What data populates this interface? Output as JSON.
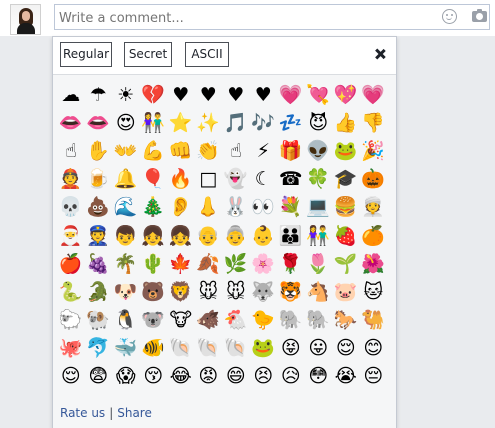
{
  "comment_box": {
    "placeholder": "Write a comment...",
    "value": ""
  },
  "picker": {
    "tabs": [
      "Regular",
      "Secret",
      "ASCII"
    ],
    "footer": {
      "rate": "Rate us",
      "separator": "|",
      "share": "Share"
    }
  },
  "emojis": [
    "☁",
    "☂",
    "☀",
    "💔",
    "♥",
    "♥",
    "♥",
    "♥",
    "💗",
    "💘",
    "💖",
    "💗",
    "👄",
    "👄",
    "😍",
    "👫",
    "⭐",
    "✨",
    "🎵",
    "🎶",
    "💤",
    "😈",
    "👍",
    "👎",
    "☝",
    "✋",
    "👐",
    "💪",
    "👊",
    "👏",
    "☝",
    "⚡",
    "🎁",
    "👽",
    "🐸",
    "🎉",
    "👲",
    "🍺",
    "🔔",
    "🎈",
    "🔥",
    "□",
    "👻",
    "☾",
    "☎",
    "🍀",
    "🎓",
    "🎃",
    "💀",
    "💩",
    "🌊",
    "🎄",
    "👂",
    "👃",
    "🐰",
    "👀",
    "💐",
    "💻",
    "🍔",
    "👳",
    "🎅",
    "👮",
    "👦",
    "👧",
    "👧",
    "👴",
    "👵",
    "👶",
    "👪",
    "👫",
    "🍓",
    "🍊",
    "🍎",
    "🍇",
    "🌴",
    "🌵",
    "🍁",
    "🍂",
    "🌿",
    "🌸",
    "🌹",
    "🌷",
    "🌱",
    "🌺",
    "🐍",
    "🐊",
    "🐶",
    "🐻",
    "🦁",
    "🐭",
    "🐭",
    "🐺",
    "🐯",
    "🐴",
    "🐷",
    "🐱",
    "🐑",
    "🐏",
    "🐧",
    "🐨",
    "🐮",
    "🐗",
    "🐔",
    "🐤",
    "🐘",
    "🐘",
    "🐎",
    "🐫",
    "🐙",
    "🐬",
    "🐳",
    "🐠",
    "🐚",
    "🐚",
    "🐚",
    "🐸",
    "😝",
    "😛",
    "😌",
    "😊",
    "😌",
    "😨",
    "😱",
    "😚",
    "😂",
    "😡",
    "😄",
    "😣",
    "😥",
    "😳",
    "😭",
    "😔"
  ],
  "colors": {
    "accent": "#365899",
    "panel_bg": "#f5f6f7",
    "page_bg": "#e9ebee"
  },
  "icons": {
    "smile": "smile-icon",
    "camera": "camera-icon",
    "close": "close-icon"
  }
}
